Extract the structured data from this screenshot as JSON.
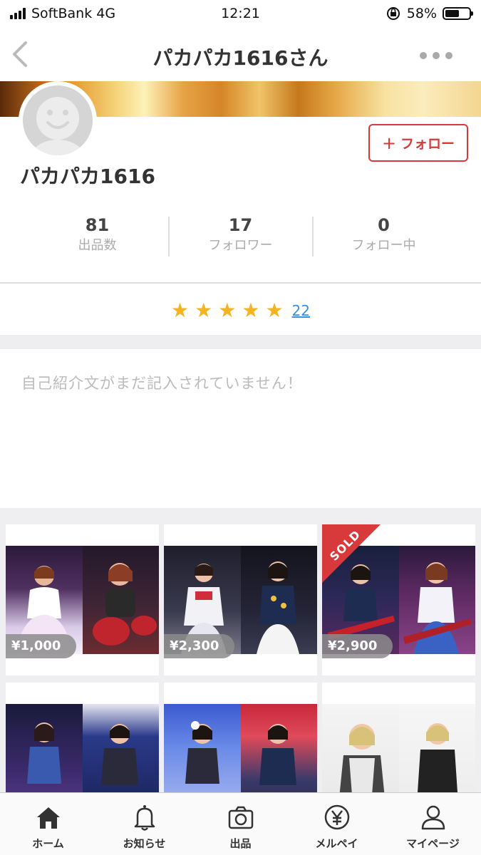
{
  "status_bar": {
    "carrier": "SoftBank 4G",
    "time": "12:21",
    "battery_percent": "58%",
    "battery_level": 0.58
  },
  "nav": {
    "title": "パカパカ1616さん"
  },
  "profile": {
    "username": "パカパカ1616",
    "follow_label": "フォロー",
    "stats": [
      {
        "value": "81",
        "label": "出品数"
      },
      {
        "value": "17",
        "label": "フォロワー"
      },
      {
        "value": "0",
        "label": "フォロー中"
      }
    ],
    "rating_stars": 5,
    "rating_count": "22",
    "bio": "自己紹介文がまだ記入されていません！"
  },
  "items": [
    {
      "price": "¥1,000",
      "sold": false
    },
    {
      "price": "¥2,300",
      "sold": false
    },
    {
      "price": "¥2,900",
      "sold": true,
      "sold_label": "SOLD"
    },
    {
      "price": "",
      "sold": false
    },
    {
      "price": "",
      "sold": false
    },
    {
      "price": "",
      "sold": false
    }
  ],
  "tab_bar": [
    {
      "label": "ホーム",
      "icon": "home-icon"
    },
    {
      "label": "お知らせ",
      "icon": "bell-icon"
    },
    {
      "label": "出品",
      "icon": "camera-icon"
    },
    {
      "label": "メルペイ",
      "icon": "yen-icon"
    },
    {
      "label": "マイページ",
      "icon": "person-icon"
    }
  ],
  "colors": {
    "accent": "#d8393b",
    "star": "#f5b221",
    "link": "#3b8fde"
  }
}
